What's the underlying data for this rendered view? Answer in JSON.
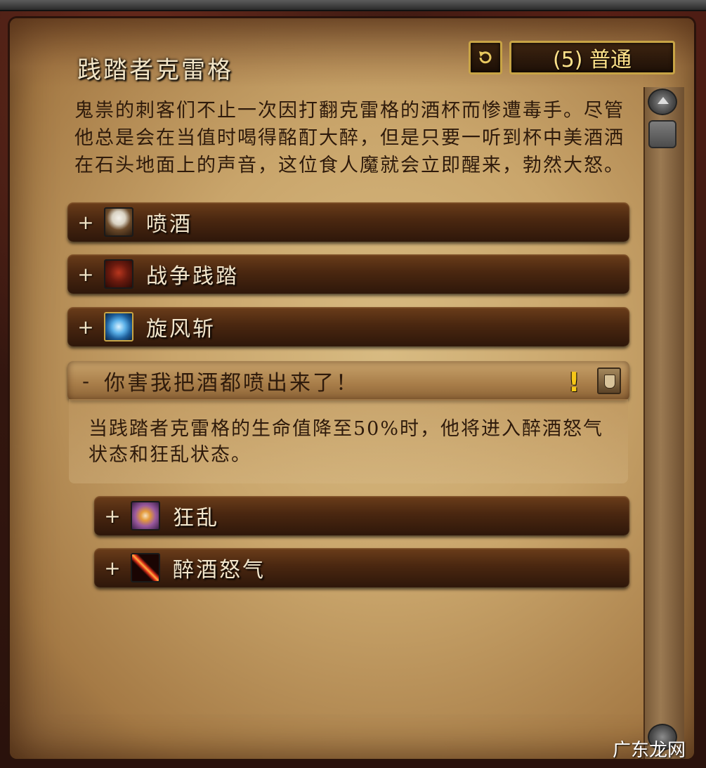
{
  "window": {
    "title": "践踏者克雷格"
  },
  "header": {
    "reset_button_icon": "reset-arrow-icon",
    "difficulty_label": "(5) 普通"
  },
  "description": "鬼祟的刺客们不止一次因打翻克雷格的酒杯而惨遭毒手。尽管他总是会在当值时喝得酩酊大醉，但是只要一听到杯中美酒洒在石头地面上的声音，这位食人魔就会立即醒来，勃然大怒。",
  "sections": [
    {
      "toggle": "+",
      "icon": "spray-brew-icon",
      "label": "喷酒"
    },
    {
      "toggle": "+",
      "icon": "war-stomp-icon",
      "label": "战争践踏"
    },
    {
      "toggle": "+",
      "icon": "whirlwind-icon",
      "label": "旋风斩"
    }
  ],
  "open_section": {
    "toggle": "-",
    "label": "你害我把酒都喷出来了！",
    "important_icon": "exclamation-icon",
    "role_icon": "tank-shield-icon",
    "text": "当践踏者克雷格的生命值降至50%时，他将进入醉酒怒气状态和狂乱状态。"
  },
  "subsections": [
    {
      "toggle": "+",
      "icon": "frenzy-icon",
      "label": "狂乱"
    },
    {
      "toggle": "+",
      "icon": "drunken-rage-icon",
      "label": "醉酒怒气"
    }
  ],
  "watermark": "广东龙网",
  "colors": {
    "parchment": "#c9a56b",
    "header_bar": "#4a2710",
    "accent_gold": "#c8a445",
    "difficulty_text": "#ffe28a"
  }
}
